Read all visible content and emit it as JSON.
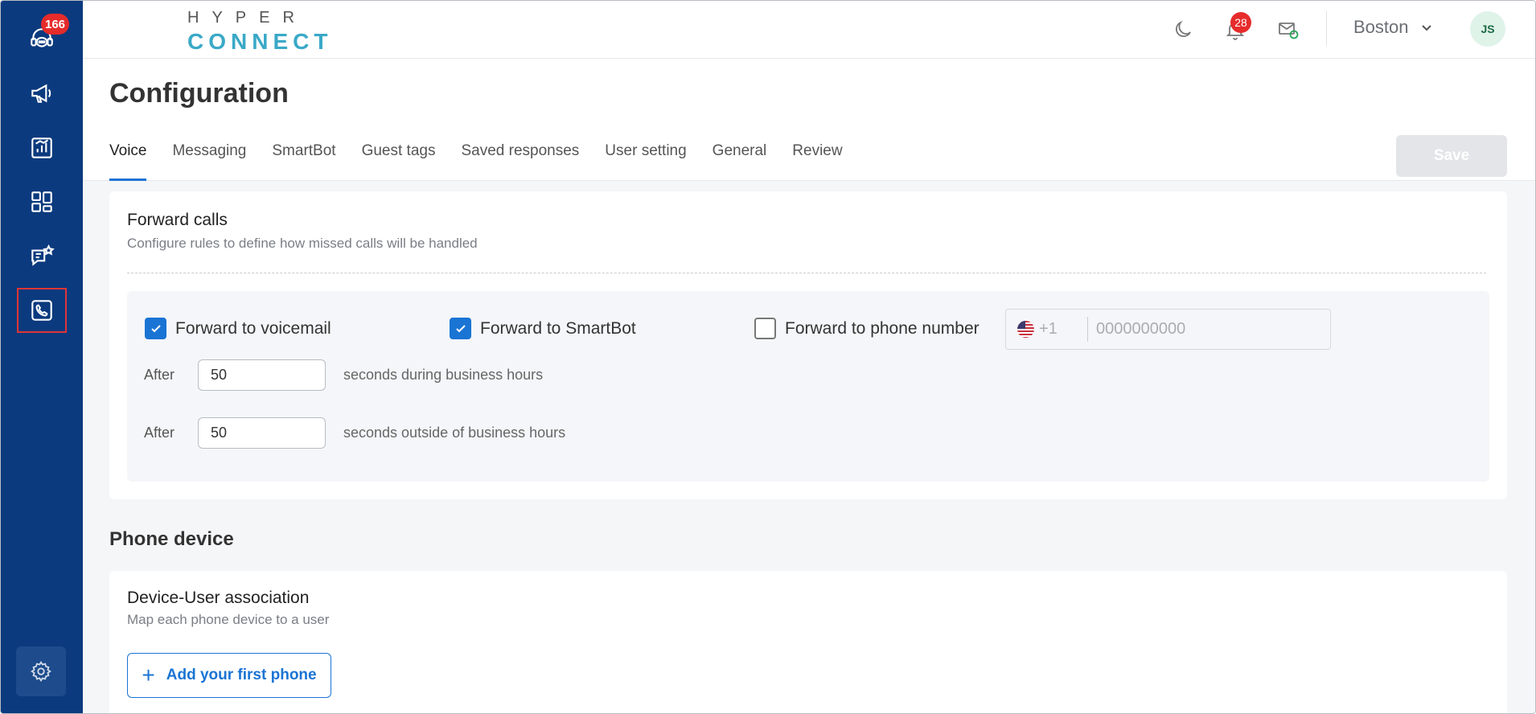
{
  "sidebar": {
    "support_badge": "166",
    "items": [
      {
        "name": "support-agent-icon"
      },
      {
        "name": "megaphone-icon"
      },
      {
        "name": "reports-icon"
      },
      {
        "name": "apps-grid-icon"
      },
      {
        "name": "reviews-chat-icon"
      },
      {
        "name": "phone-icon"
      }
    ],
    "settings_icon": "gear-icon"
  },
  "logo": {
    "top": "HYPER",
    "bottom": "CONNECT"
  },
  "topbar": {
    "notifications_badge": "28",
    "location": "Boston",
    "avatar_initials": "JS"
  },
  "page": {
    "title": "Configuration",
    "tabs": [
      "Voice",
      "Messaging",
      "SmartBot",
      "Guest tags",
      "Saved responses",
      "User setting",
      "General",
      "Review"
    ],
    "active_tab": "Voice",
    "save_label": "Save"
  },
  "forward_calls": {
    "title": "Forward calls",
    "subtitle": "Configure rules to define how missed calls will be handled",
    "options": [
      {
        "label": "Forward to voicemail",
        "checked": true
      },
      {
        "label": "Forward to SmartBot",
        "checked": true
      },
      {
        "label": "Forward to phone number",
        "checked": false
      }
    ],
    "phone": {
      "country_code": "+1",
      "placeholder": "0000000000"
    },
    "after_label": "After",
    "business_hours": {
      "value": "50",
      "desc": "seconds during business hours"
    },
    "outside_hours": {
      "value": "50",
      "desc": "seconds outside of business hours"
    }
  },
  "phone_device": {
    "section_title": "Phone device",
    "card_title": "Device-User association",
    "card_subtitle": "Map each phone device to a user",
    "add_button": "Add your first phone"
  },
  "colors": {
    "sidebar": "#0b3a7e",
    "accent": "#1a74d4",
    "badge": "#e62b2b"
  }
}
